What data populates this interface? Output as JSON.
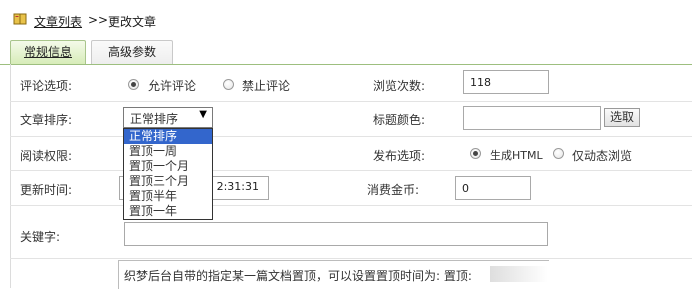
{
  "breadcrumb": {
    "link_label": "文章列表",
    "separator": ">>",
    "current": "更改文章"
  },
  "tabs": [
    {
      "label": "常规信息",
      "active": true
    },
    {
      "label": "高级参数",
      "active": false
    }
  ],
  "form": {
    "comment": {
      "label": "评论选项:",
      "options": [
        {
          "label": "允许评论",
          "checked": true
        },
        {
          "label": "禁止评论",
          "checked": false
        }
      ]
    },
    "views": {
      "label": "浏览次数:",
      "value": "118"
    },
    "sort": {
      "label": "文章排序:",
      "selected": "正常排序",
      "options": [
        "正常排序",
        "置顶一周",
        "置顶一个月",
        "置顶三个月",
        "置顶半年",
        "置顶一年"
      ]
    },
    "title_color": {
      "label": "标题颜色:",
      "value": "",
      "button_label": "选取"
    },
    "read_permission": {
      "label": "阅读权限:"
    },
    "publish": {
      "label": "发布选项:",
      "options": [
        {
          "label": "生成HTML",
          "checked": true
        },
        {
          "label": "仅动态浏览",
          "checked": false
        }
      ]
    },
    "update_time": {
      "label": "更新时间:",
      "value_visible": "2:31:31"
    },
    "coins": {
      "label": "消费金币:",
      "value": "0"
    },
    "keywords": {
      "label": "关键字:",
      "value": ""
    },
    "note": "织梦后台自带的指定某一篇文档置顶，可以设置置顶时间为: 置顶:"
  },
  "colors": {
    "tab_active_border": "#a9c58c",
    "dropdown_highlight": "#3366cc"
  }
}
